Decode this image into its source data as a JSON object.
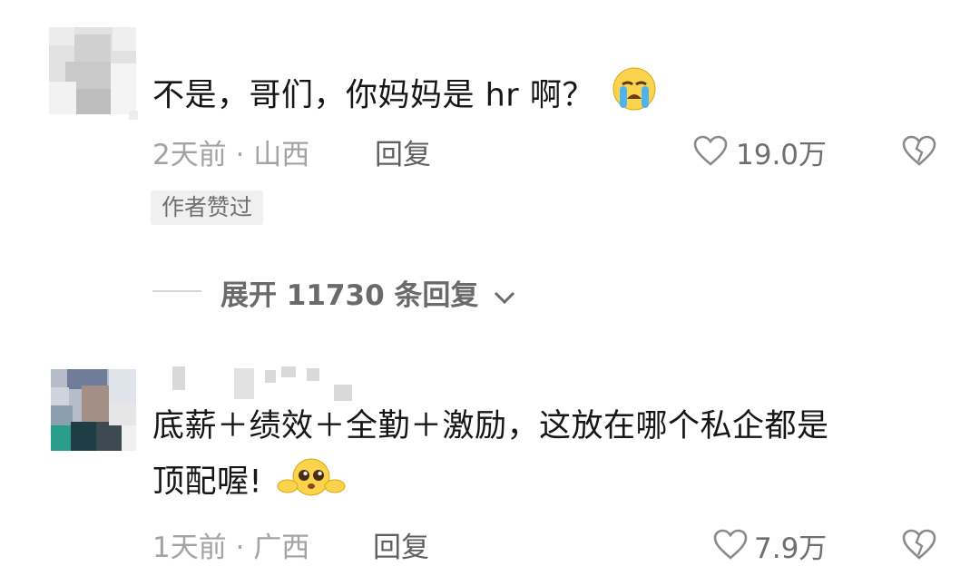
{
  "comments": [
    {
      "text": "不是，哥们，你妈妈是 hr 啊？",
      "time_location": "2天前 · 山西",
      "reply_label": "回复",
      "likes": "19.0万",
      "author_badge": "作者赞过",
      "emoji": "loudly-crying-face"
    },
    {
      "text_line1": "底薪＋绩效＋全勤＋激励，这放在哪个私企都是",
      "text_line2": "顶配喔!",
      "time_location": "1天前 · 广西",
      "reply_label": "回复",
      "likes": "7.9万",
      "emoji": "pleading-face-hands"
    }
  ],
  "expand_replies": "展开 11730 条回复",
  "colors": {
    "text": "#161616",
    "meta": "#a3a3a3",
    "badge_bg": "#f0f0f0"
  }
}
